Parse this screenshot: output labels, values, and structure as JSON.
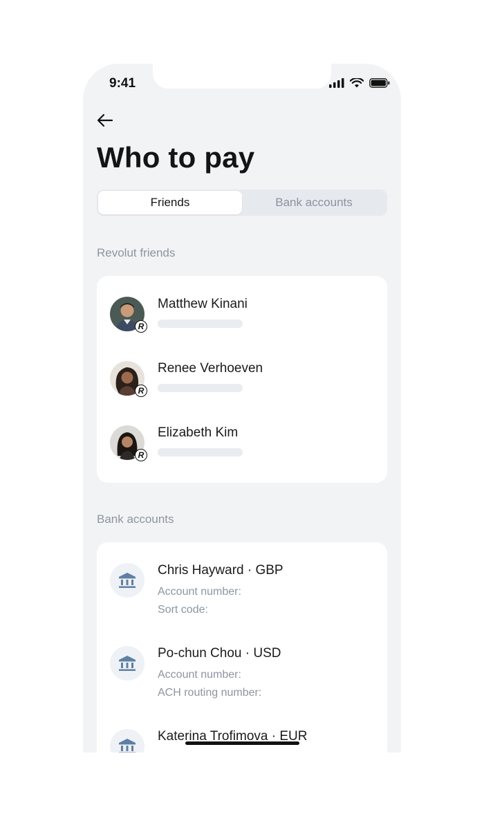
{
  "status_bar": {
    "time": "9:41"
  },
  "header": {
    "title": "Who to pay"
  },
  "tabs": [
    {
      "label": "Friends",
      "active": true
    },
    {
      "label": "Bank accounts",
      "active": false
    }
  ],
  "friends_section": {
    "label": "Revolut friends",
    "items": [
      {
        "name": "Matthew Kinani",
        "badge": "R"
      },
      {
        "name": "Renee Verhoeven",
        "badge": "R"
      },
      {
        "name": "Elizabeth Kim",
        "badge": "R"
      }
    ]
  },
  "bank_section": {
    "label": "Bank accounts",
    "items": [
      {
        "name": "Chris Hayward · GBP",
        "line1": "Account number:",
        "line2": "Sort code:"
      },
      {
        "name": "Po-chun Chou · USD",
        "line1": "Account number:",
        "line2": "ACH routing number:"
      },
      {
        "name": "Katerina Trofimova · EUR"
      }
    ]
  },
  "colors": {
    "background": "#f2f3f5",
    "card": "#ffffff",
    "muted_text": "#8d95a0",
    "bank_icon": "#5f7fa3"
  }
}
